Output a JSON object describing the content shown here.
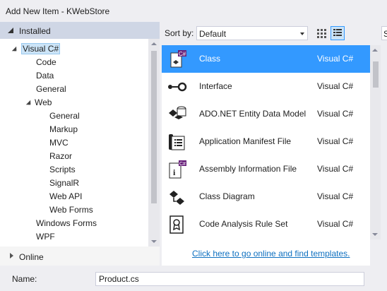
{
  "window": {
    "title": "Add New Item - KWebStore"
  },
  "left_panel": {
    "installed_label": "Installed",
    "online_label": "Online",
    "tree": [
      {
        "label": "Visual C#",
        "level": 0,
        "expanded": true,
        "selected": true
      },
      {
        "label": "Code",
        "level": 1
      },
      {
        "label": "Data",
        "level": 1
      },
      {
        "label": "General",
        "level": 1
      },
      {
        "label": "Web",
        "level": 1,
        "expanded": true
      },
      {
        "label": "General",
        "level": 2
      },
      {
        "label": "Markup",
        "level": 2
      },
      {
        "label": "MVC",
        "level": 2
      },
      {
        "label": "Razor",
        "level": 2
      },
      {
        "label": "Scripts",
        "level": 2
      },
      {
        "label": "SignalR",
        "level": 2
      },
      {
        "label": "Web API",
        "level": 2
      },
      {
        "label": "Web Forms",
        "level": 2
      },
      {
        "label": "Windows Forms",
        "level": 1
      },
      {
        "label": "WPF",
        "level": 1
      }
    ]
  },
  "toolbar": {
    "sort_label": "Sort by:",
    "sort_value": "Default",
    "search_stub": "S"
  },
  "templates": [
    {
      "name": "Class",
      "lang": "Visual C#",
      "icon": "class-icon",
      "selected": true
    },
    {
      "name": "Interface",
      "lang": "Visual C#",
      "icon": "interface-icon"
    },
    {
      "name": "ADO.NET Entity Data Model",
      "lang": "Visual C#",
      "icon": "entity-model-icon"
    },
    {
      "name": "Application Manifest File",
      "lang": "Visual C#",
      "icon": "manifest-icon"
    },
    {
      "name": "Assembly Information File",
      "lang": "Visual C#",
      "icon": "assembly-info-icon"
    },
    {
      "name": "Class Diagram",
      "lang": "Visual C#",
      "icon": "class-diagram-icon"
    },
    {
      "name": "Code Analysis Rule Set",
      "lang": "Visual C#",
      "icon": "rule-set-icon"
    }
  ],
  "online_link": "Click here to go online and find templates.",
  "name_field": {
    "label": "Name:",
    "value": "Product.cs"
  },
  "colors": {
    "selection": "#3399ff",
    "link": "#0e70c0",
    "installed_header": "#cfd6e5"
  }
}
